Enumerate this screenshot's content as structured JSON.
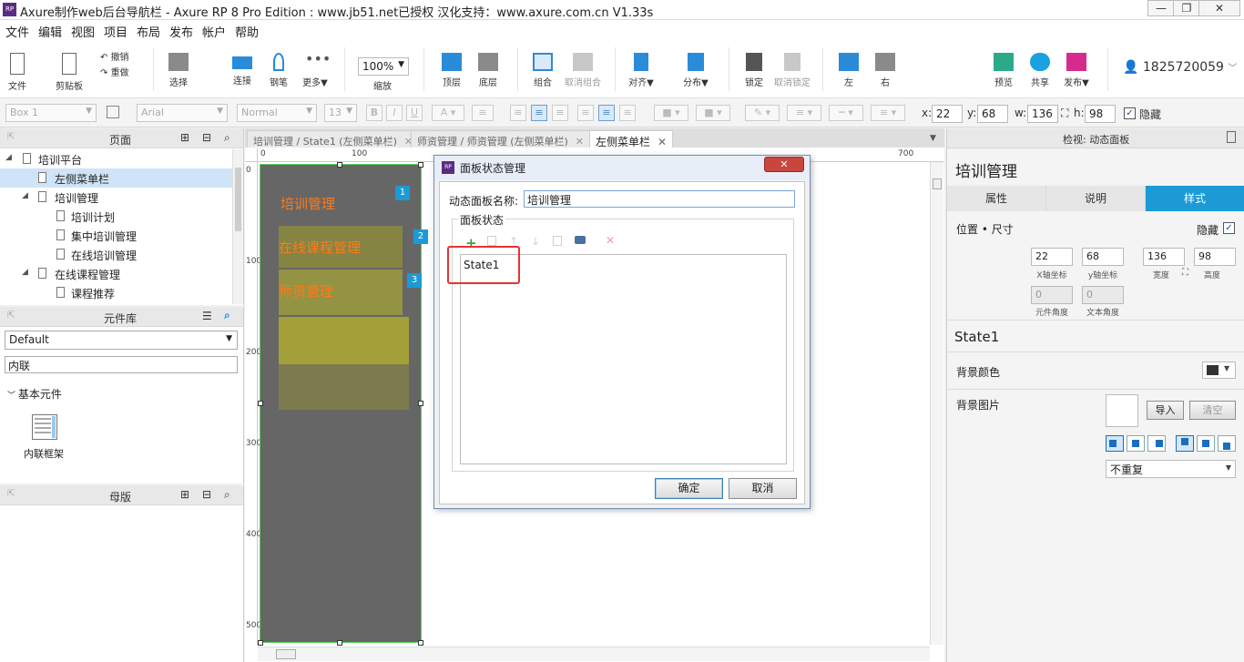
{
  "window": {
    "title": "Axure制作web后台导航栏 - Axure RP 8 Pro Edition : www.jb51.net已授权 汉化支持：www.axure.com.cn V1.33s",
    "app_icon": "RP"
  },
  "menu": [
    "文件",
    "编辑",
    "视图",
    "项目",
    "布局",
    "发布",
    "帐户",
    "帮助"
  ],
  "toolbar": {
    "file": "文件",
    "clipboard": "剪贴板",
    "undo": "撤销",
    "redo": "重做",
    "select": "选择",
    "connect": "连接",
    "pen": "钢笔",
    "more": "更多▼",
    "zoom_value": "100%",
    "zoom": "缩放",
    "top": "顶层",
    "bottom": "底层",
    "group": "组合",
    "ungroup": "取消组合",
    "align": "对齐▼",
    "distribute": "分布▼",
    "lock": "锁定",
    "unlock": "取消锁定",
    "left": "左",
    "right": "右",
    "preview": "预览",
    "share": "共享",
    "publish": "发布▼",
    "user": "1825720059"
  },
  "format": {
    "style": "Box 1",
    "font": "Arial",
    "weight": "Normal",
    "size": "13",
    "bold": "B",
    "italic": "I",
    "underline": "U",
    "x_label": "x:",
    "x": "22",
    "y_label": "y:",
    "y": "68",
    "w_label": "w:",
    "w": "136",
    "h_label": "h:",
    "h": "98",
    "hidden": "隐藏"
  },
  "pages_panel": {
    "title": "页面",
    "items": [
      {
        "label": "培训平台",
        "level": 0
      },
      {
        "label": "左侧菜单栏",
        "level": 1
      },
      {
        "label": "培训管理",
        "level": 1
      },
      {
        "label": "培训计划",
        "level": 2
      },
      {
        "label": "集中培训管理",
        "level": 2
      },
      {
        "label": "在线培训管理",
        "level": 2
      },
      {
        "label": "在线课程管理",
        "level": 1
      },
      {
        "label": "课程推荐",
        "level": 2
      }
    ]
  },
  "library_panel": {
    "title": "元件库",
    "library": "Default",
    "search": "内联",
    "group": "基本元件",
    "widget": "内联框架"
  },
  "masters_panel": {
    "title": "母版"
  },
  "tabs": [
    {
      "label": "培训管理 / State1 (左侧菜单栏)"
    },
    {
      "label": "师资管理 / 师资管理 (左侧菜单栏)"
    },
    {
      "label": "左侧菜单栏"
    }
  ],
  "ruler": {
    "h": [
      "0",
      "100",
      "700"
    ],
    "v": [
      "0",
      "100",
      "200",
      "300",
      "400",
      "500"
    ]
  },
  "canvas": {
    "menu1": "培训管理",
    "menu2": "在线课程管理",
    "menu3": "师资管理",
    "badge1": "1",
    "badge2": "2",
    "badge3": "3"
  },
  "dialog": {
    "title": "面板状态管理",
    "name_label": "动态面板名称:",
    "name_value": "培训管理",
    "group_label": "面板状态",
    "state": "State1",
    "ok": "确定",
    "cancel": "取消"
  },
  "inspector": {
    "header": "检视: 动态面板",
    "name": "培训管理",
    "tabs": [
      "属性",
      "说明",
      "样式"
    ],
    "section_pos": "位置 • 尺寸",
    "hidden": "隐藏",
    "x": "22",
    "y": "68",
    "w": "136",
    "h": "98",
    "x_cap": "X轴坐标",
    "y_cap": "y轴坐标",
    "w_cap": "宽度",
    "h_cap": "高度",
    "rot": "0",
    "text_rot": "0",
    "rot_cap": "元件角度",
    "text_rot_cap": "文本角度",
    "state": "State1",
    "bg_color": "背景颜色",
    "bg_image": "背景图片",
    "import": "导入",
    "clear": "清空",
    "repeat": "不重复"
  },
  "colors": {
    "accent": "#1b9ad6",
    "canvas_gray": "#666666",
    "highlight": "#e53333",
    "orange_text": "#ff7a1a"
  }
}
